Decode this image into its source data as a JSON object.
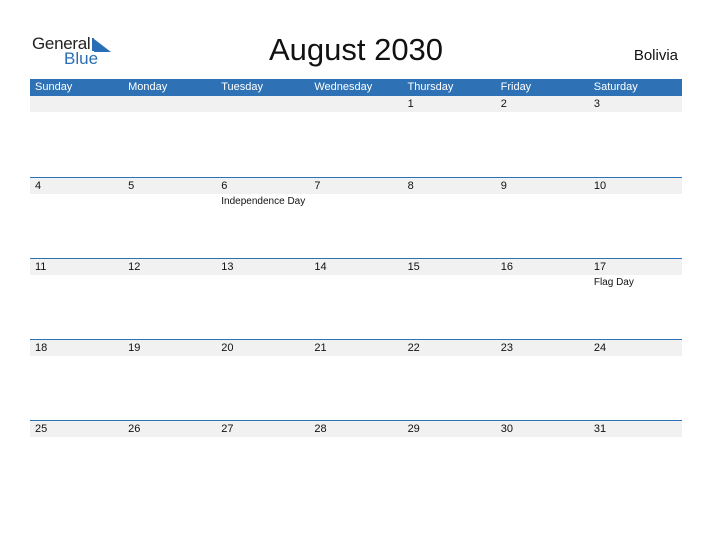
{
  "logo": {
    "word1": "General",
    "word2": "Blue"
  },
  "title": "August 2030",
  "country": "Bolivia",
  "colors": {
    "accent": "#2e72b5",
    "date_strip": "#f1f1f1"
  },
  "weekdays": [
    "Sunday",
    "Monday",
    "Tuesday",
    "Wednesday",
    "Thursday",
    "Friday",
    "Saturday"
  ],
  "weeks": [
    [
      {
        "day": ""
      },
      {
        "day": ""
      },
      {
        "day": ""
      },
      {
        "day": ""
      },
      {
        "day": "1"
      },
      {
        "day": "2"
      },
      {
        "day": "3"
      }
    ],
    [
      {
        "day": "4"
      },
      {
        "day": "5"
      },
      {
        "day": "6",
        "holiday": "Independence Day"
      },
      {
        "day": "7"
      },
      {
        "day": "8"
      },
      {
        "day": "9"
      },
      {
        "day": "10"
      }
    ],
    [
      {
        "day": "11"
      },
      {
        "day": "12"
      },
      {
        "day": "13"
      },
      {
        "day": "14"
      },
      {
        "day": "15"
      },
      {
        "day": "16"
      },
      {
        "day": "17",
        "holiday": "Flag Day"
      }
    ],
    [
      {
        "day": "18"
      },
      {
        "day": "19"
      },
      {
        "day": "20"
      },
      {
        "day": "21"
      },
      {
        "day": "22"
      },
      {
        "day": "23"
      },
      {
        "day": "24"
      }
    ],
    [
      {
        "day": "25"
      },
      {
        "day": "26"
      },
      {
        "day": "27"
      },
      {
        "day": "28"
      },
      {
        "day": "29"
      },
      {
        "day": "30"
      },
      {
        "day": "31"
      }
    ]
  ]
}
